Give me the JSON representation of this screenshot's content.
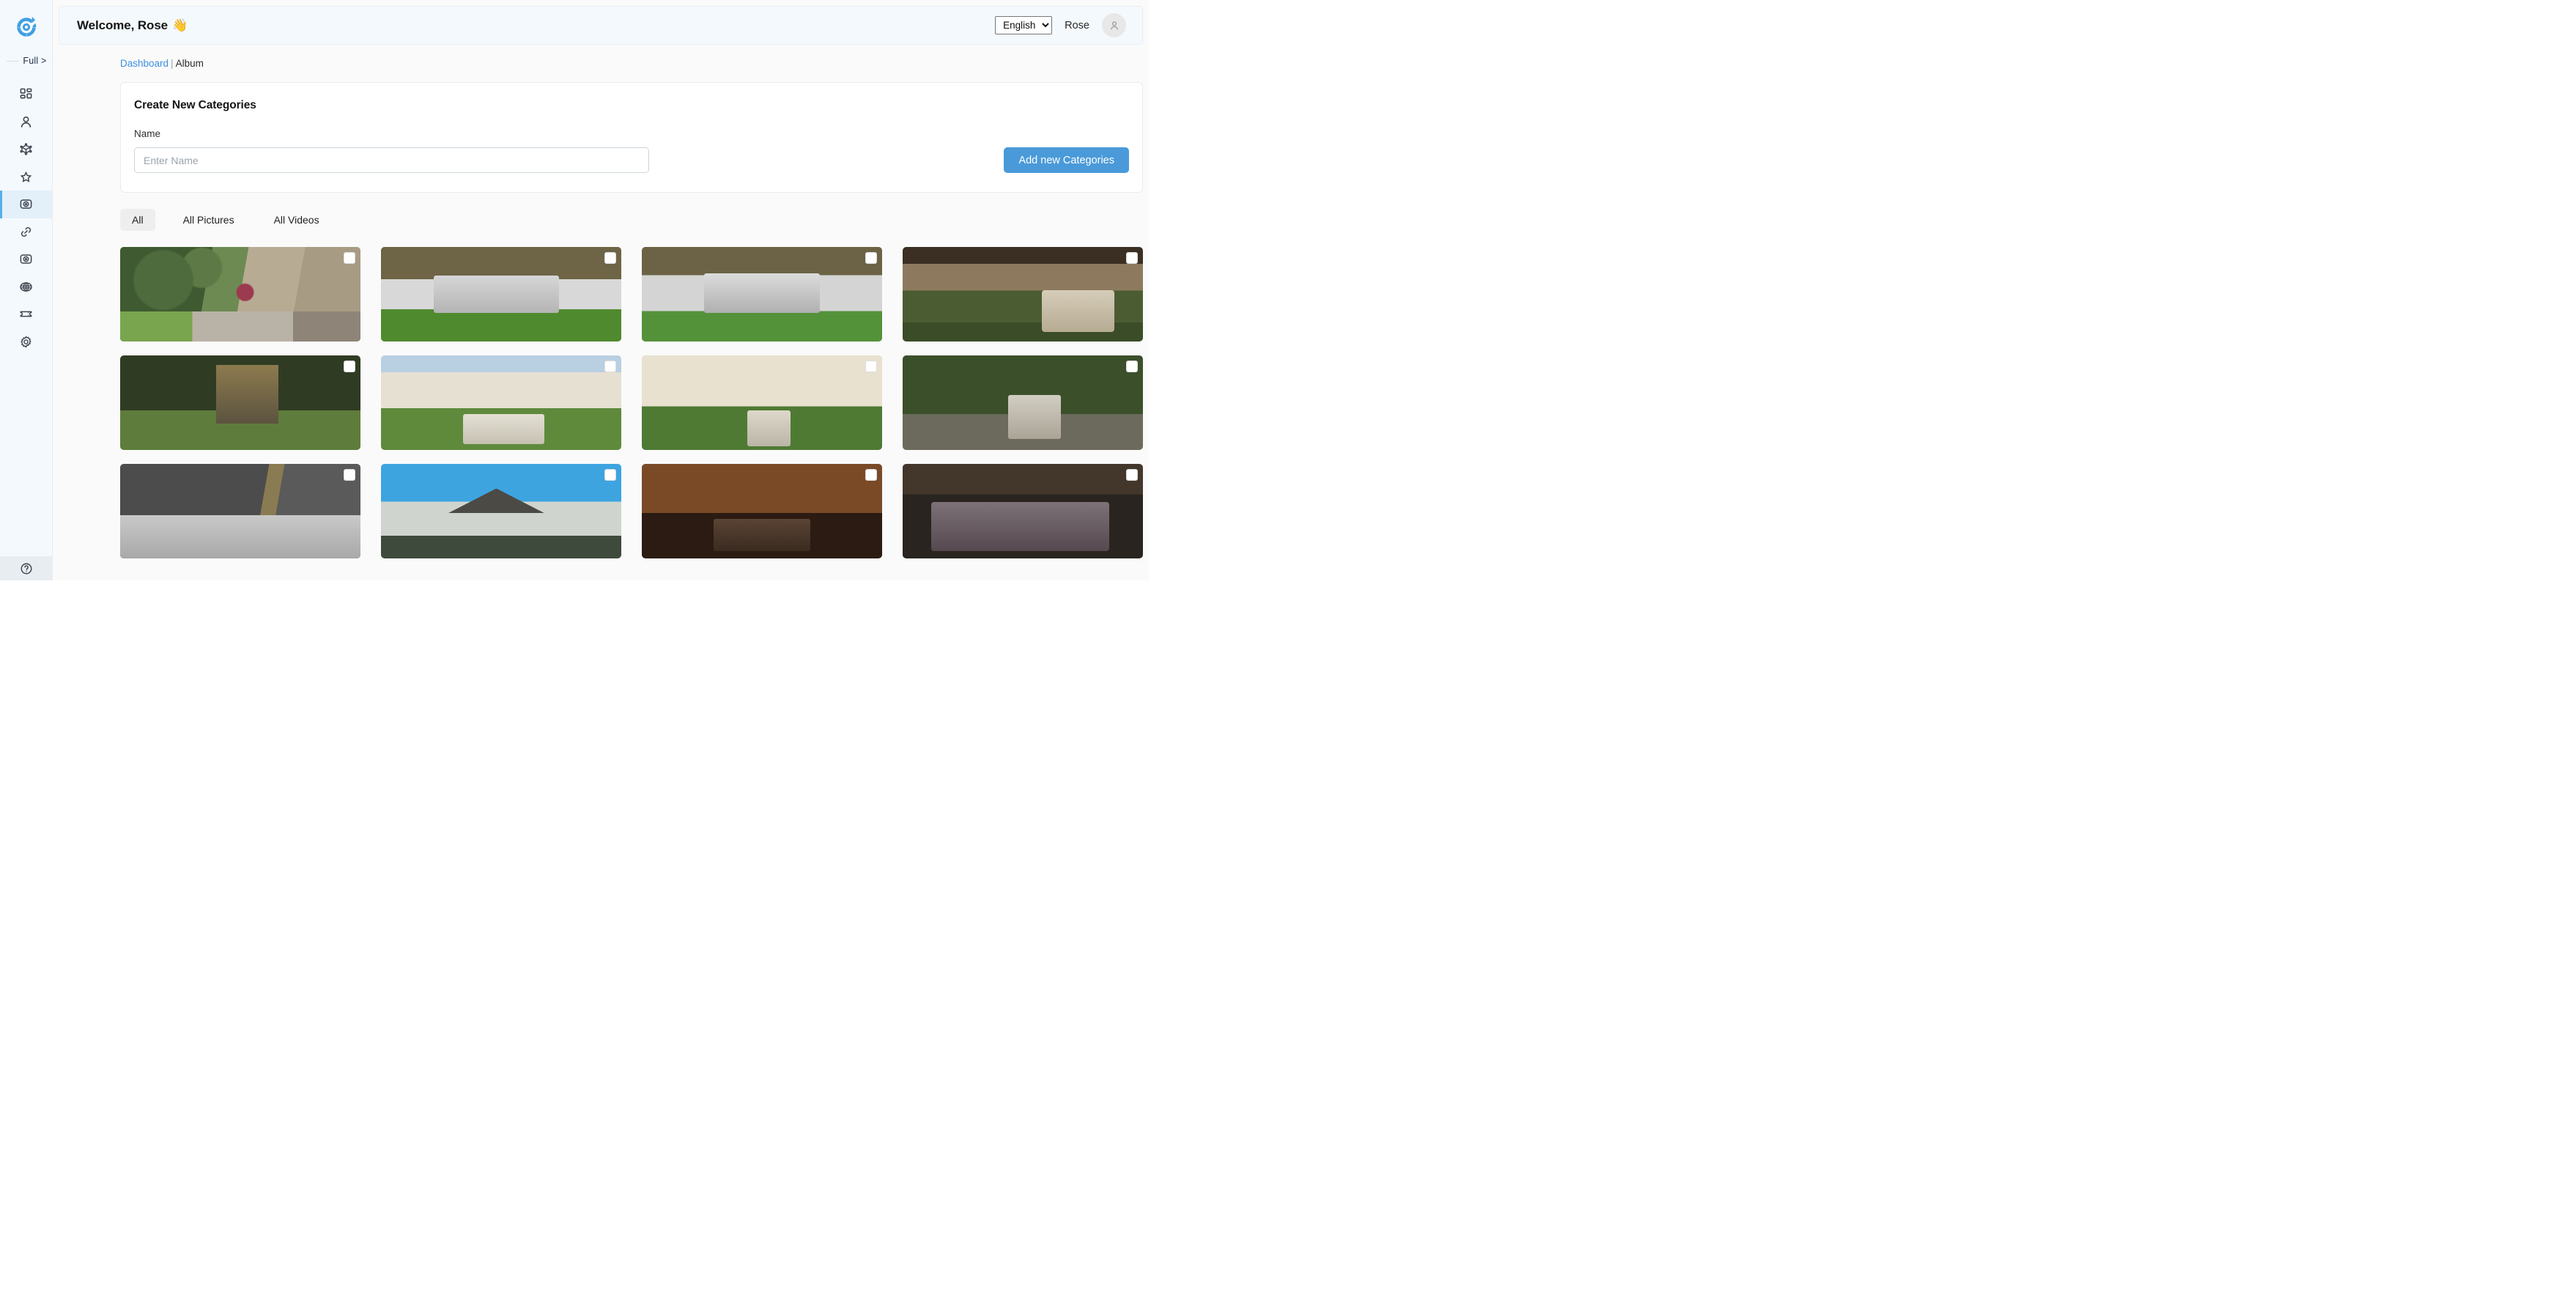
{
  "sidebar": {
    "logo_icon": "brand-target-logo",
    "collapse": {
      "label": "Full >"
    },
    "items": [
      {
        "name": "dashboard",
        "icon": "grid-icon",
        "active": false
      },
      {
        "name": "users",
        "icon": "person-icon",
        "active": false
      },
      {
        "name": "products",
        "icon": "cube-icon",
        "active": false
      },
      {
        "name": "favorites",
        "icon": "star-icon",
        "active": false
      },
      {
        "name": "album",
        "icon": "camera-icon",
        "active": true
      },
      {
        "name": "links",
        "icon": "link-icon",
        "active": false
      },
      {
        "name": "media",
        "icon": "camera-icon",
        "active": false
      },
      {
        "name": "website",
        "icon": "globe-icon",
        "active": false
      },
      {
        "name": "tickets",
        "icon": "ticket-icon",
        "active": false
      },
      {
        "name": "settings",
        "icon": "gear-icon",
        "active": false
      }
    ],
    "help_icon": "question-circle-icon"
  },
  "topbar": {
    "welcome": "Welcome, Rose",
    "welcome_emoji": "👋",
    "language": {
      "selected": "English",
      "options": [
        "English"
      ]
    },
    "user_name": "Rose",
    "avatar_icon": "person-icon"
  },
  "breadcrumb": {
    "parent": "Dashboard",
    "separator": "|",
    "current": "Album"
  },
  "create_card": {
    "title": "Create New Categories",
    "name_label": "Name",
    "name_value": "",
    "name_placeholder": "Enter Name",
    "submit_label": "Add new Categories",
    "accent_color": "#4a9ad9"
  },
  "tabs": [
    {
      "label": "All",
      "active": true
    },
    {
      "label": "All Pictures",
      "active": false
    },
    {
      "label": "All Videos",
      "active": false
    }
  ],
  "gallery": {
    "checkbox_checked": false,
    "items": [
      {
        "alt": "garden patio with fig tree, flower pots and wooden bench",
        "style": "p1"
      },
      {
        "alt": "grey lounge sofa set with white table on artificial grass",
        "style": "p2"
      },
      {
        "alt": "grey corner lounge set against slatted wood wall",
        "style": "p3"
      },
      {
        "alt": "blurred hedge with beige cushioned garden chair",
        "style": "p4"
      },
      {
        "alt": "garden pergola with cushioned chair on lawn",
        "style": "p5"
      },
      {
        "alt": "white manor house with garden chairs on lawn",
        "style": "p6"
      },
      {
        "alt": "villa facade with awnings and single garden chair",
        "style": "p7"
      },
      {
        "alt": "tree-lined path with two garden chairs",
        "style": "p8"
      },
      {
        "alt": "grey outdoor sofa with throw and statue",
        "style": "p9"
      },
      {
        "alt": "courtyard with parasol and dining set under blue sky",
        "style": "p10"
      },
      {
        "alt": "wicker lounge set lit against wooden fence at night",
        "style": "p11"
      },
      {
        "alt": "dark wicker corner sofa with cushions and table",
        "style": "p12"
      }
    ]
  }
}
